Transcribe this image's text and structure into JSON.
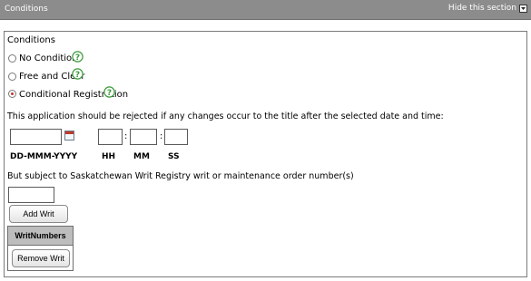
{
  "header": {
    "title": "Conditions",
    "hide_label": "Hide this section"
  },
  "panel": {
    "heading": "Conditions",
    "options": [
      {
        "label": "No Conditions",
        "checked": false
      },
      {
        "label": "Free and Clear",
        "checked": false
      },
      {
        "label": "Conditional Registration",
        "checked": true
      }
    ],
    "reject_text": "This application should be rejected if any changes occur to the title after the selected date and time:",
    "date_label": "DD-MMM-YYYY",
    "time_sep": ":",
    "hh_label": "HH",
    "mm_label": "MM",
    "ss_label": "SS",
    "writ_text": "But subject to Saskatchewan Writ Registry writ or maintenance order number(s)",
    "add_writ": "Add Writ",
    "table_header": "WritNumbers",
    "remove_writ": "Remove Writ"
  }
}
